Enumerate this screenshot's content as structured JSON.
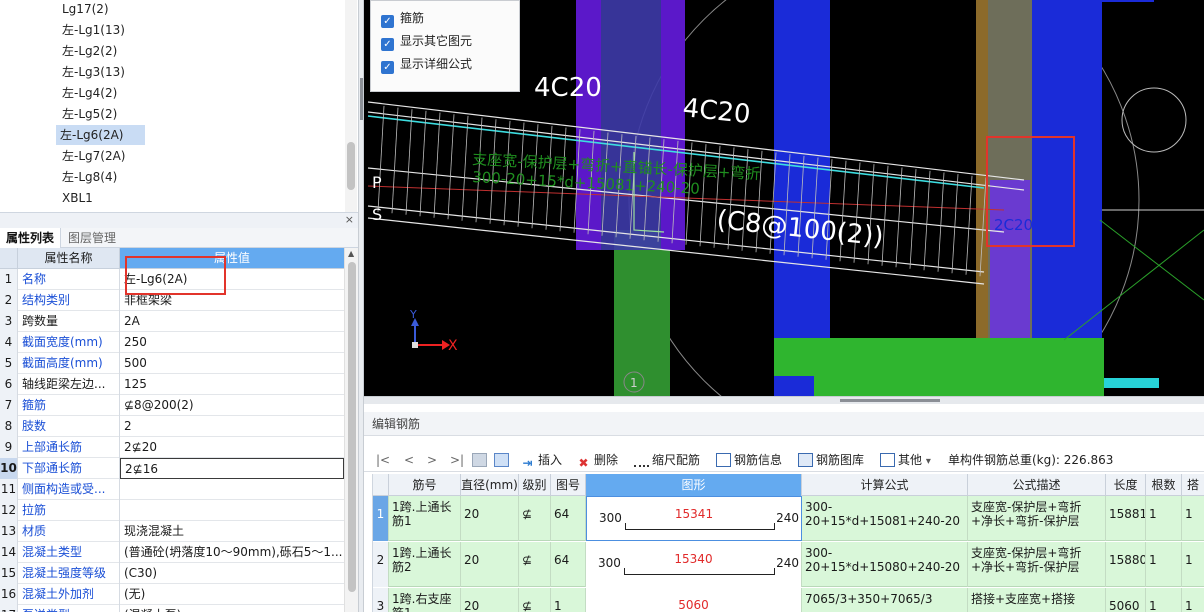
{
  "tree": {
    "items": [
      "Lg17(2)",
      "左-Lg1(13)",
      "左-Lg2(2)",
      "左-Lg3(13)",
      "左-Lg4(2)",
      "左-Lg5(2)",
      "左-Lg6(2A)",
      "左-Lg7(2A)",
      "左-Lg8(4)",
      "XBL1"
    ],
    "selected_index": 6
  },
  "properties": {
    "close_glyph": "×",
    "tabs": [
      "属性列表",
      "图层管理"
    ],
    "col_name": "属性名称",
    "col_value": "属性值",
    "rows": [
      {
        "idx": "1",
        "name": "名称",
        "value": "左-Lg6(2A)",
        "blue": true
      },
      {
        "idx": "2",
        "name": "结构类别",
        "value": "非框架梁",
        "blue": true
      },
      {
        "idx": "3",
        "name": "跨数量",
        "value": "2A",
        "blue": false
      },
      {
        "idx": "4",
        "name": "截面宽度(mm)",
        "value": "250",
        "blue": true
      },
      {
        "idx": "5",
        "name": "截面高度(mm)",
        "value": "500",
        "blue": true
      },
      {
        "idx": "6",
        "name": "轴线距梁左边...",
        "value": "125",
        "blue": false
      },
      {
        "idx": "7",
        "name": "箍筋",
        "value": "⊈8@200(2)",
        "blue": true
      },
      {
        "idx": "8",
        "name": "肢数",
        "value": "2",
        "blue": true
      },
      {
        "idx": "9",
        "name": "上部通长筋",
        "value": "2⊈20",
        "blue": true
      },
      {
        "idx": "10",
        "name": "下部通长筋",
        "value": "2⊈16",
        "blue": true
      },
      {
        "idx": "11",
        "name": "侧面构造或受...",
        "value": "",
        "blue": true
      },
      {
        "idx": "12",
        "name": "拉筋",
        "value": "",
        "blue": true
      },
      {
        "idx": "13",
        "name": "材质",
        "value": "现浇混凝土",
        "blue": true
      },
      {
        "idx": "14",
        "name": "混凝土类型",
        "value": "(普通砼(坍落度10～90mm),砾石5～1...",
        "blue": true
      },
      {
        "idx": "15",
        "name": "混凝土强度等级",
        "value": "(C30)",
        "blue": true
      },
      {
        "idx": "16",
        "name": "混凝土外加剂",
        "value": "(无)",
        "blue": true
      },
      {
        "idx": "17",
        "name": "泵送类型",
        "value": "(混凝土泵)",
        "blue": true
      }
    ],
    "active_row": "10"
  },
  "viewport": {
    "options": [
      "箍筋",
      "显示其它图元",
      "显示详细公式"
    ],
    "labels": {
      "rebar_a": "4C20",
      "rebar_b": "4C20",
      "stirrup": "(C8@100(2))",
      "formula_desc": "支座宽-保护层+弯折+直锚长-保护层+弯折",
      "formula_value": "300-20+15*d+15081+240-20",
      "side_p": "P",
      "side_s": "S",
      "end_label": "2C20",
      "axis_marker": "1",
      "axis_x": "X",
      "axis_y": "Y"
    },
    "colors": {
      "beam_purple": "#5b18c9",
      "beam_blue": "#1a2bd8",
      "column_green": "#2e9a2e",
      "rebar_white": "#e6e6e6",
      "rebar_cyan": "#3ddde0",
      "formula_green": "#1f8f1f",
      "label_yellow": "#e3c23a"
    }
  },
  "rebar": {
    "title": "编辑钢筋",
    "nav": [
      "|<",
      "<",
      ">",
      ">|"
    ],
    "toolbar": {
      "insert": "插入",
      "delete": "删除",
      "scale": "缩尺配筋",
      "info": "钢筋信息",
      "library": "钢筋图库",
      "other": "其他",
      "other_caret": "▾",
      "total_weight": "单构件钢筋总重(kg): 226.863"
    },
    "columns": [
      "筋号",
      "直径(mm)",
      "级别",
      "图号",
      "图形",
      "计算公式",
      "公式描述",
      "长度",
      "根数",
      "搭"
    ],
    "rows": [
      {
        "idx": "1",
        "name": "1跨.上通长筋1",
        "dia": "20",
        "grade": "⊈",
        "fig": "64",
        "left": "300",
        "mid": "15341",
        "right": "240",
        "formula": "300-20+15*d+15081+240-20",
        "desc": "支座宽-保护层+弯折+净长+弯折-保护层",
        "length": "15881",
        "count": "1",
        "lap": "1"
      },
      {
        "idx": "2",
        "name": "1跨.上通长筋2",
        "dia": "20",
        "grade": "⊈",
        "fig": "64",
        "left": "300",
        "mid": "15340",
        "right": "240",
        "formula": "300-20+15*d+15080+240-20",
        "desc": "支座宽-保护层+弯折+净长+弯折-保护层",
        "length": "15880",
        "count": "1",
        "lap": "1"
      },
      {
        "idx": "3",
        "name": "1跨.右支座筋1",
        "dia": "20",
        "grade": "⊈",
        "fig": "1",
        "left": "",
        "mid": "5060",
        "right": "",
        "formula": "7065/3+350+7065/3",
        "desc": "搭接+支座宽+搭接",
        "length": "5060",
        "count": "1",
        "lap": "1"
      }
    ],
    "active_row": "1"
  }
}
